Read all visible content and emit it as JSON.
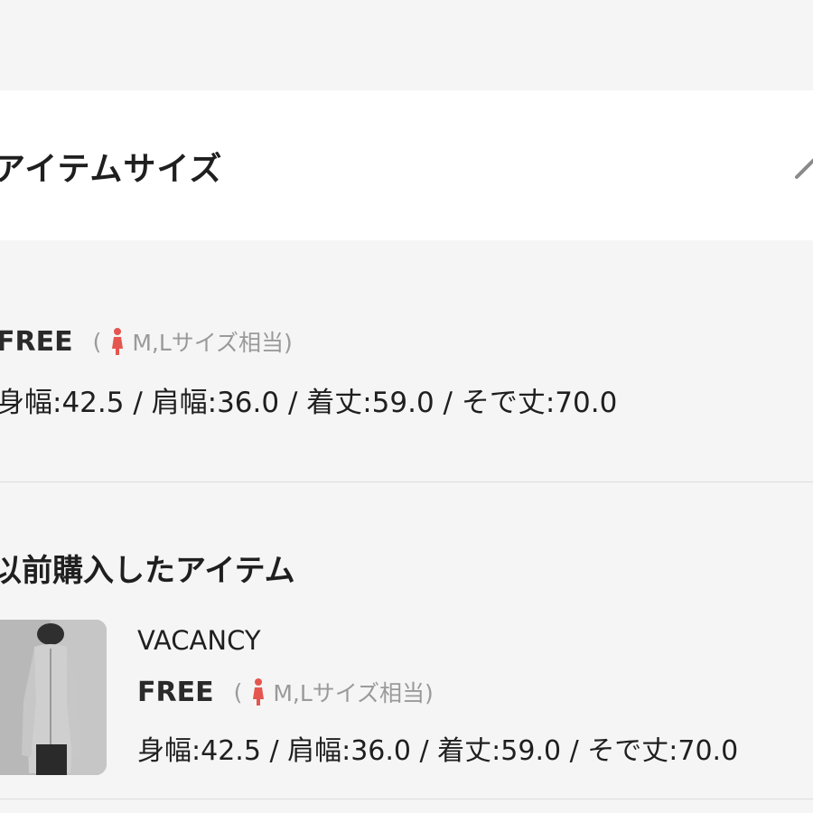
{
  "header": {
    "title": "アイテムサイズ",
    "edit_icon": "pencil-icon"
  },
  "current_size": {
    "size_name": "FREE",
    "equiv_open": "(",
    "equiv_text": "M,Lサイズ相当)",
    "person_icon": "female-person-icon",
    "measurements": "身幅:42.5 / 肩幅:36.0 / 着丈:59.0 / そで丈:70.0"
  },
  "purchased": {
    "section_title": "以前購入したアイテム",
    "items": [
      {
        "brand": "VACANCY",
        "size_name": "FREE",
        "equiv_open": "(",
        "equiv_text": "M,Lサイズ相当)",
        "measurements": "身幅:42.5 / 肩幅:36.0 / 着丈:59.0 / そで丈:70.0"
      }
    ]
  },
  "colors": {
    "background": "#f5f5f5",
    "card": "#ffffff",
    "accent_person": "#e4564f",
    "muted_text": "#9a9a9a",
    "divider": "#dedede"
  }
}
